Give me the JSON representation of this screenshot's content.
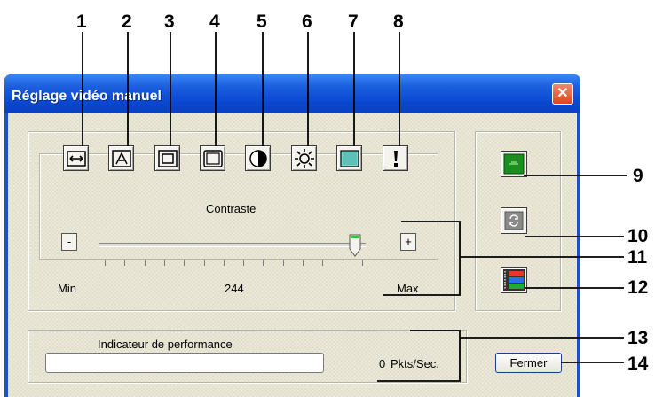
{
  "callouts": [
    "1",
    "2",
    "3",
    "4",
    "5",
    "6",
    "7",
    "8",
    "9",
    "10",
    "11",
    "12",
    "13",
    "14"
  ],
  "window": {
    "title": "Réglage vidéo manuel",
    "close_glyph": "✕"
  },
  "toolbar_icons": [
    "width-arrows-icon",
    "picture-adjust-icon",
    "frame-inset-icon",
    "frame-outset-icon",
    "contrast-icon",
    "brightness-icon",
    "color-icon",
    "warning-icon"
  ],
  "slider": {
    "label": "Contraste",
    "minus": "-",
    "plus": "+",
    "min_label": "Min",
    "max_label": "Max",
    "value": "244",
    "value_fraction": 0.96
  },
  "right_buttons": [
    "green-panel-icon",
    "refresh-icon",
    "color-bars-icon"
  ],
  "performance": {
    "label": "Indicateur de performance",
    "rate": "0",
    "unit": "Pkts/Sec."
  },
  "close_button": {
    "label": "Fermer"
  }
}
